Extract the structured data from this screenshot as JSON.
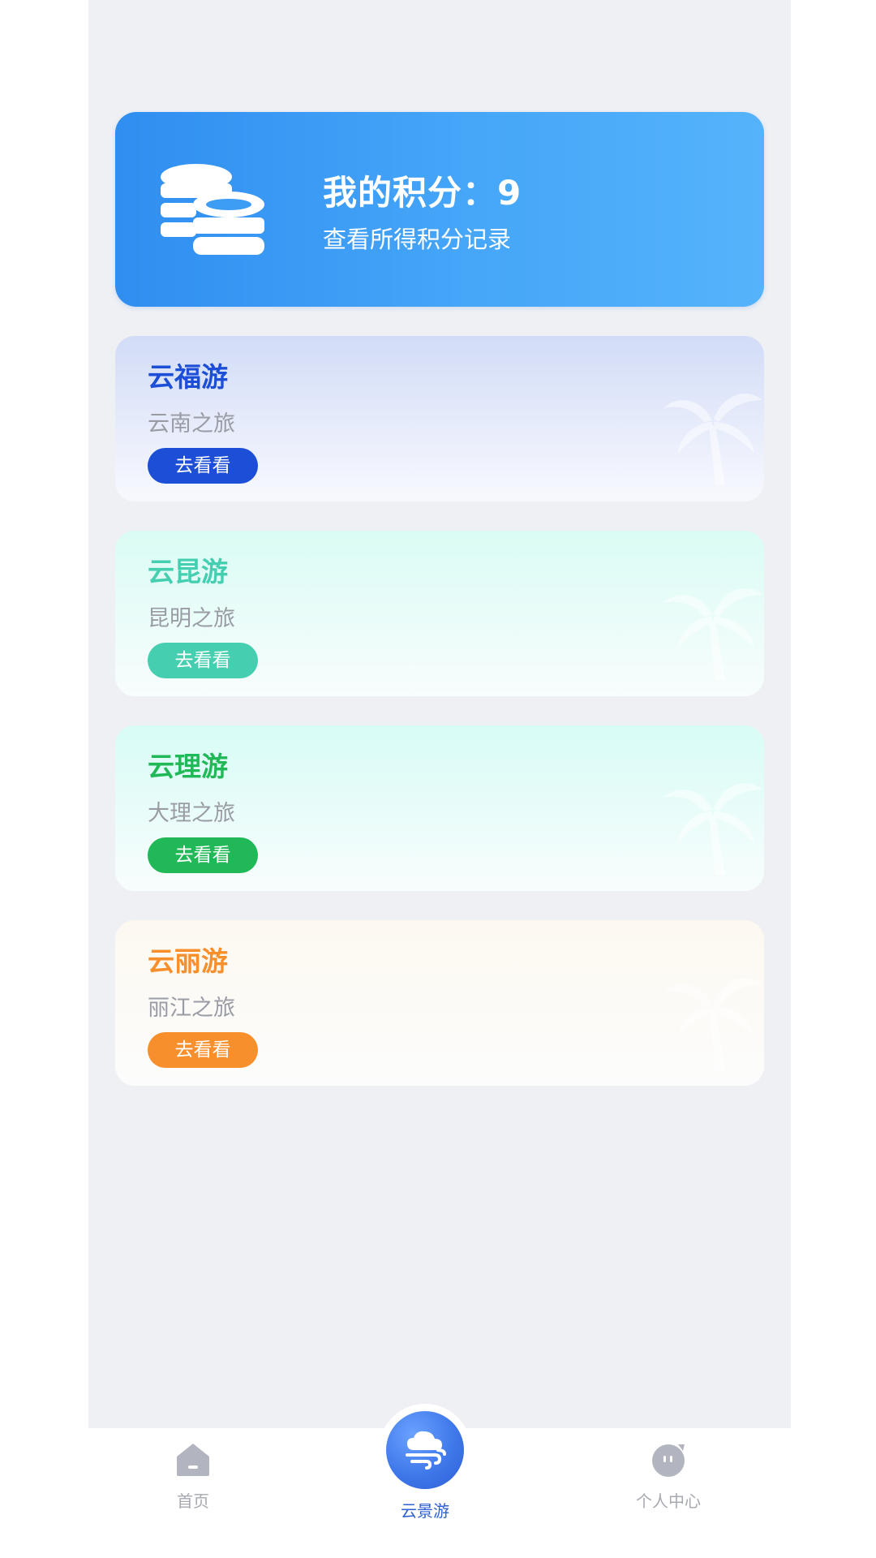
{
  "points": {
    "title": "我的积分：9",
    "subtitle": "查看所得积分记录",
    "icon": "coins-stack-icon"
  },
  "tours": [
    {
      "title": "云福游",
      "subtitle": "云南之旅",
      "button": "去看看",
      "accent": "#1c4fd6",
      "bg_top": "#d2dcf7",
      "bg_bottom": "#f8f9fe"
    },
    {
      "title": "云昆游",
      "subtitle": "昆明之旅",
      "button": "去看看",
      "accent": "#45cfb0",
      "bg_top": "#dafcf4",
      "bg_bottom": "#f8fdfd"
    },
    {
      "title": "云理游",
      "subtitle": "大理之旅",
      "button": "去看看",
      "accent": "#21b957",
      "bg_top": "#d8fcf6",
      "bg_bottom": "#f8fdfd"
    },
    {
      "title": "云丽游",
      "subtitle": "丽江之旅",
      "button": "去看看",
      "accent": "#f7902c",
      "bg_top": "#fdf9f1",
      "bg_bottom": "#fcfcfc"
    }
  ],
  "tabbar": {
    "home": {
      "label": "首页",
      "icon": "home-icon"
    },
    "center": {
      "label": "云景游",
      "icon": "cloud-wind-icon"
    },
    "profile": {
      "label": "个人中心",
      "icon": "profile-face-icon"
    }
  },
  "colors": {
    "primary": "#3f78ea",
    "inactive": "#a7a9b1"
  }
}
